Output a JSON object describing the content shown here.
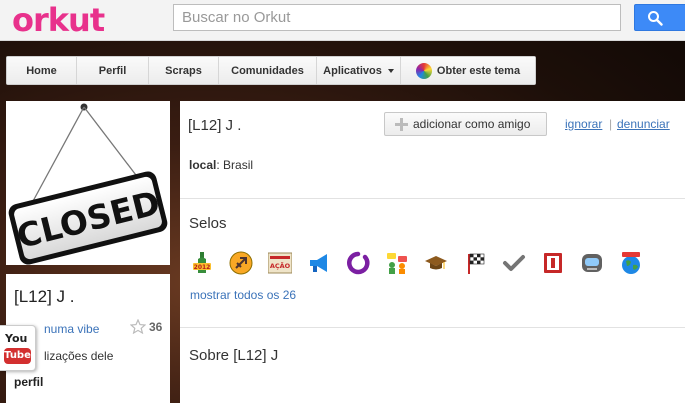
{
  "header": {
    "logo": "orkut",
    "search_placeholder": "Buscar no Orkut"
  },
  "nav": {
    "items": [
      "Home",
      "Perfil",
      "Scraps",
      "Comunidades",
      "Aplicativos"
    ],
    "theme_label": "Obter este tema"
  },
  "profile_card": {
    "name": "[L12] J .",
    "vibe": "numa vibe",
    "stars": "36",
    "updates": "lizações dele",
    "perfil": "perfil"
  },
  "photo": {
    "sign_text": "CLOSED"
  },
  "youtube": {
    "you": "You",
    "tube": "Tube"
  },
  "main": {
    "name": "[L12] J .",
    "add_friend": "adicionar como amigo",
    "ignore": "ignorar",
    "separator": "|",
    "report": "denunciar",
    "local_label": "local",
    "local_value": ": Brasil",
    "selos_title": "Selos",
    "show_all": "mostrar todos os 26",
    "sobre": "Sobre [L12] J"
  },
  "badges": [
    {
      "icon": "bottle-2012-icon",
      "text": "2012"
    },
    {
      "icon": "sagittarius-icon"
    },
    {
      "icon": "superacao-icon",
      "text": "AÇÃO"
    },
    {
      "icon": "megaphone-icon"
    },
    {
      "icon": "purple-ring-icon"
    },
    {
      "icon": "chat-people-icon"
    },
    {
      "icon": "graduation-cap-icon"
    },
    {
      "icon": "checkered-flag-icon"
    },
    {
      "icon": "checkmark-icon"
    },
    {
      "icon": "red-book-icon"
    },
    {
      "icon": "robot-face-icon"
    },
    {
      "icon": "globe-icon"
    }
  ],
  "colors": {
    "brand": "#e8318c",
    "link": "#3b73b9",
    "search_button": "#3d8af7"
  }
}
